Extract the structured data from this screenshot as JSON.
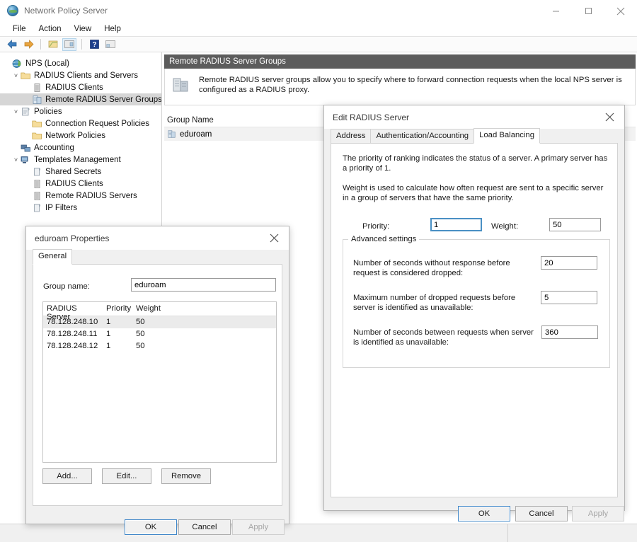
{
  "window": {
    "title": "Network Policy Server",
    "app_icon": "globe-icon",
    "minimize": "minimize-icon",
    "maximize": "maximize-icon",
    "close": "close-icon"
  },
  "menubar": {
    "items": [
      {
        "label": "File"
      },
      {
        "label": "Action"
      },
      {
        "label": "View"
      },
      {
        "label": "Help"
      }
    ]
  },
  "toolbar": {
    "buttons": [
      {
        "name": "back-arrow-icon",
        "title": "Back"
      },
      {
        "name": "forward-arrow-icon",
        "title": "Forward"
      },
      {
        "name": "show-hide-tree-icon",
        "title": "Show/Hide Console Tree"
      },
      {
        "name": "properties-icon",
        "title": "Properties"
      },
      {
        "name": "help-icon",
        "title": "Help"
      },
      {
        "name": "export-list-icon",
        "title": "Export List"
      }
    ]
  },
  "tree": {
    "nodes": [
      {
        "label": "NPS (Local)",
        "indent": 0,
        "chevron": "",
        "icon": "nps-globe-icon",
        "selected": false
      },
      {
        "label": "RADIUS Clients and Servers",
        "indent": 1,
        "chevron": "v",
        "icon": "folder-icon",
        "selected": false
      },
      {
        "label": "RADIUS Clients",
        "indent": 2,
        "chevron": "",
        "icon": "server-icon",
        "selected": false
      },
      {
        "label": "Remote RADIUS Server Groups",
        "indent": 2,
        "chevron": "",
        "icon": "server-group-icon",
        "selected": true
      },
      {
        "label": "Policies",
        "indent": 1,
        "chevron": "v",
        "icon": "policy-icon",
        "selected": false
      },
      {
        "label": "Connection Request Policies",
        "indent": 2,
        "chevron": "",
        "icon": "folder-icon",
        "selected": false
      },
      {
        "label": "Network Policies",
        "indent": 2,
        "chevron": "",
        "icon": "folder-icon",
        "selected": false
      },
      {
        "label": "Accounting",
        "indent": 1,
        "chevron": "",
        "icon": "accounting-icon",
        "selected": false
      },
      {
        "label": "Templates Management",
        "indent": 1,
        "chevron": "v",
        "icon": "templates-icon",
        "selected": false
      },
      {
        "label": "Shared Secrets",
        "indent": 2,
        "chevron": "",
        "icon": "shared-secret-icon",
        "selected": false
      },
      {
        "label": "RADIUS Clients",
        "indent": 2,
        "chevron": "",
        "icon": "server-icon",
        "selected": false
      },
      {
        "label": "Remote RADIUS Servers",
        "indent": 2,
        "chevron": "",
        "icon": "server-icon",
        "selected": false
      },
      {
        "label": "IP Filters",
        "indent": 2,
        "chevron": "",
        "icon": "ip-filter-icon",
        "selected": false
      }
    ]
  },
  "content": {
    "header_title": "Remote RADIUS Server Groups",
    "description": "Remote RADIUS server groups allow you to specify where to forward connection requests when the local NPS server is configured as a RADIUS proxy.",
    "description_icon": "server-stack-icon",
    "list_column_header": "Group Name",
    "rows": [
      {
        "name": "eduroam",
        "icon": "server-group-icon"
      }
    ]
  },
  "properties_dialog": {
    "title": "eduroam Properties",
    "close": "close-icon",
    "tabs": [
      {
        "label": "General",
        "active": true
      }
    ],
    "group_name_label": "Group name:",
    "group_name_value": "eduroam",
    "table": {
      "columns": [
        "RADIUS Server",
        "Priority",
        "Weight"
      ],
      "rows": [
        {
          "server": "78.128.248.10",
          "priority": "1",
          "weight": "50",
          "selected": true
        },
        {
          "server": "78.128.248.11",
          "priority": "1",
          "weight": "50",
          "selected": false
        },
        {
          "server": "78.128.248.12",
          "priority": "1",
          "weight": "50",
          "selected": false
        }
      ]
    },
    "list_buttons": [
      {
        "label": "Add...",
        "name": "add-button",
        "disabled": false
      },
      {
        "label": "Edit...",
        "name": "edit-button",
        "disabled": false
      },
      {
        "label": "Remove",
        "name": "remove-button",
        "disabled": false
      }
    ],
    "footer_buttons": [
      {
        "label": "OK",
        "name": "ok-button",
        "default": true,
        "disabled": false
      },
      {
        "label": "Cancel",
        "name": "cancel-button",
        "default": false,
        "disabled": false
      },
      {
        "label": "Apply",
        "name": "apply-button",
        "default": false,
        "disabled": true
      }
    ]
  },
  "edit_radius_dialog": {
    "title": "Edit RADIUS Server",
    "close": "close-icon",
    "tabs": [
      {
        "label": "Address",
        "active": false
      },
      {
        "label": "Authentication/Accounting",
        "active": false
      },
      {
        "label": "Load Balancing",
        "active": true
      }
    ],
    "paragraph_1": "The priority of ranking indicates the status of a server. A primary server has a priority of 1.",
    "paragraph_2": "Weight is used to calculate how often request are sent to a specific server in a group of servers that have the same priority.",
    "priority_label": "Priority:",
    "priority_value": "1",
    "weight_label": "Weight:",
    "weight_value": "50",
    "advanced_group_title": "Advanced settings",
    "advanced_fields": [
      {
        "label": "Number of seconds without response before request is considered dropped:",
        "value": "20",
        "name": "seconds-without-response-field"
      },
      {
        "label": "Maximum number of dropped requests before server is identified as unavailable:",
        "value": "5",
        "name": "max-dropped-requests-field"
      },
      {
        "label": "Number of seconds between requests when server is identified as unavailable:",
        "value": "360",
        "name": "seconds-between-requests-field"
      }
    ],
    "footer_buttons": [
      {
        "label": "OK",
        "name": "ok-button",
        "default": true,
        "disabled": false
      },
      {
        "label": "Cancel",
        "name": "cancel-button",
        "default": false,
        "disabled": false
      },
      {
        "label": "Apply",
        "name": "apply-button",
        "default": false,
        "disabled": true
      }
    ]
  },
  "colors": {
    "header_bar": "#5c5c5c",
    "selection": "#d6d6d6",
    "focus_blue": "#4a90c4",
    "default_button_border": "#3f86c8"
  }
}
